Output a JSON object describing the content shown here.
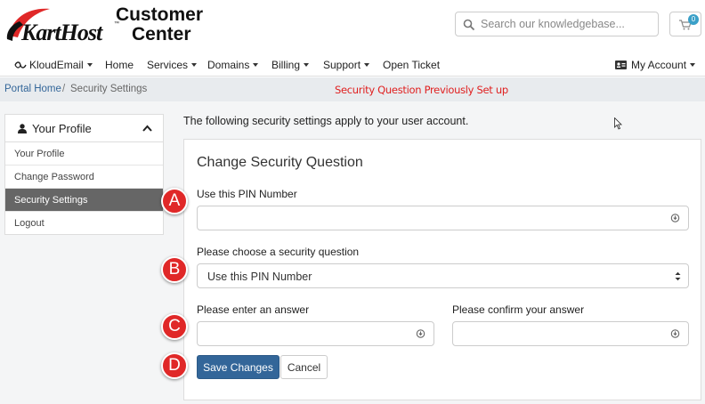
{
  "header": {
    "logo_text": "KartHost",
    "logo_tm": "™",
    "logo_line1": "Customer",
    "logo_line2": "Center",
    "search_placeholder": "Search our knowledgebase...",
    "cart_count": "0"
  },
  "nav": {
    "items": [
      {
        "label": "KloudEmail"
      },
      {
        "label": "Home"
      },
      {
        "label": "Services"
      },
      {
        "label": "Domains"
      },
      {
        "label": "Billing"
      },
      {
        "label": "Support"
      },
      {
        "label": "Open Ticket"
      }
    ],
    "account_label": "My Account"
  },
  "breadcrumb": {
    "home": "Portal Home",
    "separator": "/",
    "current": "Security Settings"
  },
  "annotation_title": "Security Question Previously Set up",
  "sidebar": {
    "title": "Your Profile",
    "items": [
      {
        "label": "Your Profile"
      },
      {
        "label": "Change Password"
      },
      {
        "label": "Security Settings"
      },
      {
        "label": "Logout"
      }
    ]
  },
  "content": {
    "intro": "The following security settings apply to your user account.",
    "card_title": "Change Security Question",
    "pin_label": "Use this PIN Number",
    "pin_value": "",
    "question_label": "Please choose a security question",
    "question_selected": "Use this PIN Number",
    "answer_label": "Please enter an answer",
    "answer_value": "",
    "confirm_label": "Please confirm your answer",
    "confirm_value": "",
    "save_label": "Save Changes",
    "cancel_label": "Cancel"
  },
  "markers": [
    "A",
    "B",
    "C",
    "D"
  ],
  "colors": {
    "accent": "#336699",
    "marker": "#e02828",
    "annotation": "#e02020",
    "sidebar_active": "#666666"
  }
}
